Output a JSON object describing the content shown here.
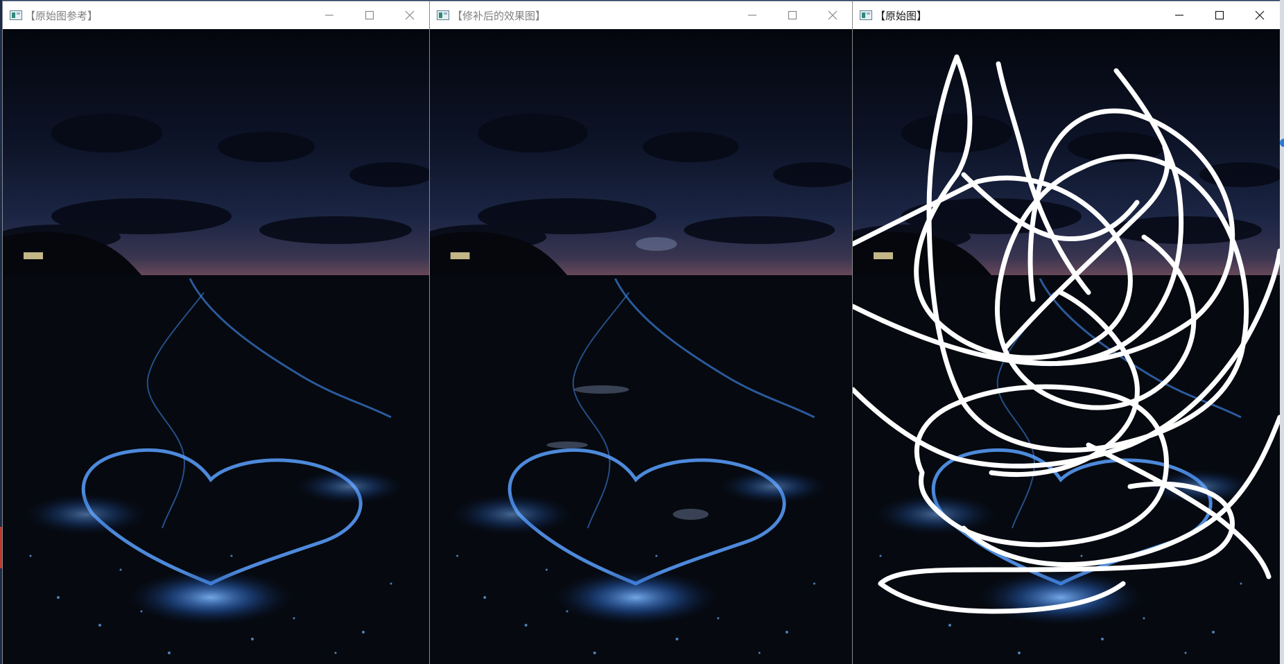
{
  "windows": [
    {
      "id": "reference",
      "title": "【原始图参考】",
      "active": false
    },
    {
      "id": "repaired",
      "title": "【修补后的效果图】",
      "active": false
    },
    {
      "id": "original",
      "title": "【原始图】",
      "active": true
    }
  ],
  "controls": {
    "minimize_icon": "minimize-icon",
    "maximize_icon": "maximize-icon",
    "close_icon": "close-icon"
  },
  "colors": {
    "sky_top": "#05070f",
    "sky_mid": "#1b2440",
    "horizon": "#6b4a5a",
    "sea": "#070b15",
    "glow": "#3d8cff",
    "scribble": "#ffffff"
  }
}
